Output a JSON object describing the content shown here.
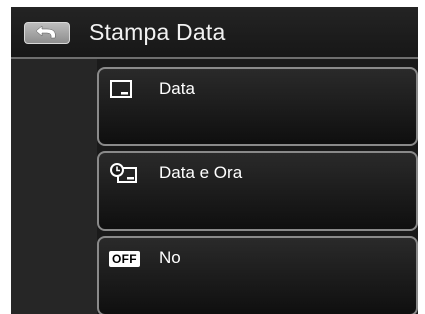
{
  "header": {
    "title": "Stampa Data",
    "back_icon": "back-arrow-icon"
  },
  "menu": {
    "items": [
      {
        "label": "Data",
        "icon": "date-stamp-icon"
      },
      {
        "label": "Data e Ora",
        "icon": "date-time-stamp-icon"
      },
      {
        "label": "No",
        "icon": "off-icon",
        "badge": "OFF"
      }
    ]
  },
  "colors": {
    "background": "#1a1a1a",
    "item_border": "#8a8a8a",
    "text": "#ffffff"
  }
}
